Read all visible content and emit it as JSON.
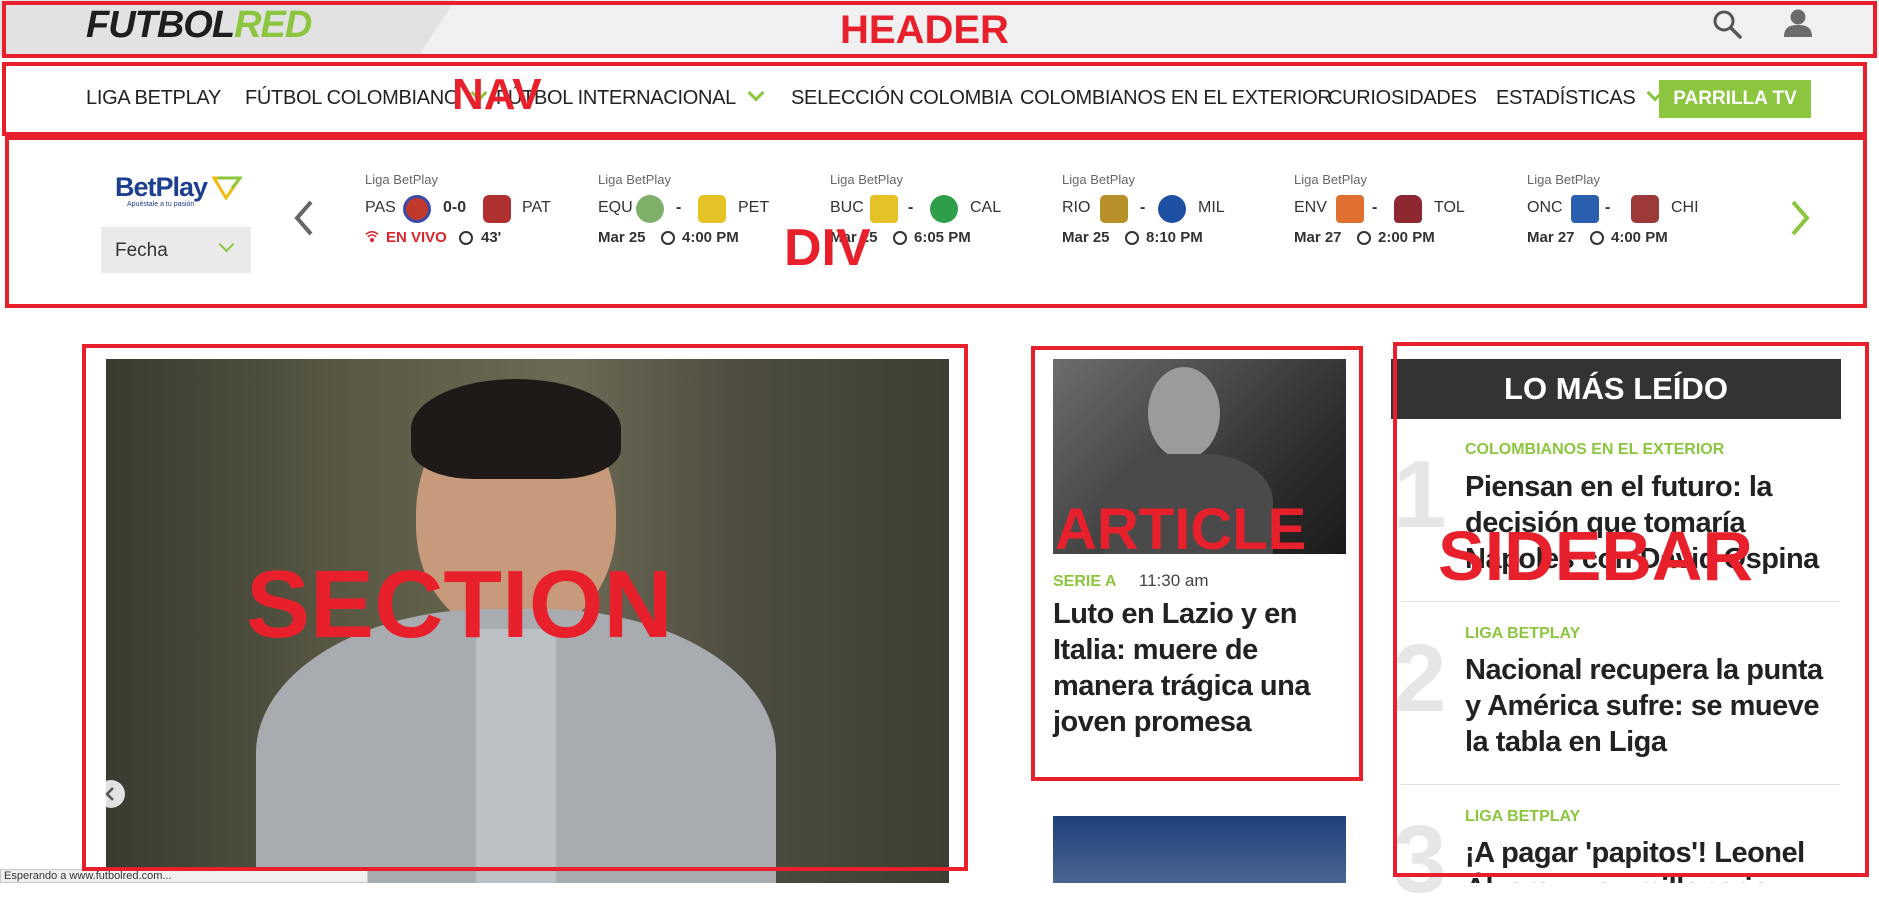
{
  "header": {
    "logo_part1": "FUTBOL",
    "logo_part2": "RED",
    "label": "HEADER"
  },
  "nav": {
    "label": "NAV",
    "items": [
      {
        "label": "LIGA BETPLAY"
      },
      {
        "label": "FÚTBOL COLOMBIANO"
      },
      {
        "label": "FÚTBOL INTERNACIONAL"
      },
      {
        "label": "SELECCIÓN COLOMBIA"
      },
      {
        "label": "COLOMBIANOS EN EL EXTERIOR"
      },
      {
        "label": "CURIOSIDADES"
      },
      {
        "label": "ESTADÍSTICAS"
      }
    ],
    "cta": "PARRILLA TV"
  },
  "scores": {
    "label": "DIV",
    "sponsor": "BetPlay",
    "sponsor_tagline": "Apuéstale a tu pasión",
    "date_select": "Fecha",
    "matches": [
      {
        "league": "Liga BetPlay",
        "home": "PAS",
        "away": "PAT",
        "score": "0-0",
        "status": "EN VIVO",
        "time": "43'",
        "home_color": "#c0392b",
        "away_color": "#b03030"
      },
      {
        "league": "Liga BetPlay",
        "home": "EQU",
        "away": "PET",
        "score": "-",
        "date": "Mar 25",
        "time": "4:00 PM",
        "home_color": "#7fb069",
        "away_color": "#e6c229"
      },
      {
        "league": "Liga BetPlay",
        "home": "BUC",
        "away": "CAL",
        "score": "-",
        "date": "Mar 25",
        "time": "6:05 PM",
        "home_color": "#e6c229",
        "away_color": "#2e9e48"
      },
      {
        "league": "Liga BetPlay",
        "home": "RIO",
        "away": "MIL",
        "score": "-",
        "date": "Mar 25",
        "time": "8:10 PM",
        "home_color": "#b8902a",
        "away_color": "#1d4fa3"
      },
      {
        "league": "Liga BetPlay",
        "home": "ENV",
        "away": "TOL",
        "score": "-",
        "date": "Mar 27",
        "time": "2:00 PM",
        "home_color": "#e07030",
        "away_color": "#8e2730"
      },
      {
        "league": "Liga BetPlay",
        "home": "ONC",
        "away": "CHI",
        "score": "-",
        "date": "Mar 27",
        "time": "4:00 PM",
        "home_color": "#2a5fb0",
        "away_color": "#9c3a3a"
      }
    ]
  },
  "main": {
    "label": "SECTION"
  },
  "article": {
    "label": "ARTICLE",
    "category": "SERIE A",
    "time": "11:30 am",
    "headline": "Luto en Lazio y en Italia: muere de manera trágica una joven promesa"
  },
  "sidebar": {
    "label": "SIDEBAR",
    "title": "LO MÁS LEÍDO",
    "items": [
      {
        "num": "1",
        "category": "COLOMBIANOS EN EL EXTERIOR",
        "headline": "Piensan en el futuro: la decisión que tomaría Napoles con David Ospina"
      },
      {
        "num": "2",
        "category": "LIGA BETPLAY",
        "headline": "Nacional recupera la punta y América sufre: se mueve la tabla en Liga"
      },
      {
        "num": "3",
        "category": "LIGA BETPLAY",
        "headline": "¡A pagar 'papitos'! Leonel Álvarez y su millonario"
      }
    ]
  },
  "statusbar": {
    "text": "Esperando a www.futbolred.com..."
  }
}
